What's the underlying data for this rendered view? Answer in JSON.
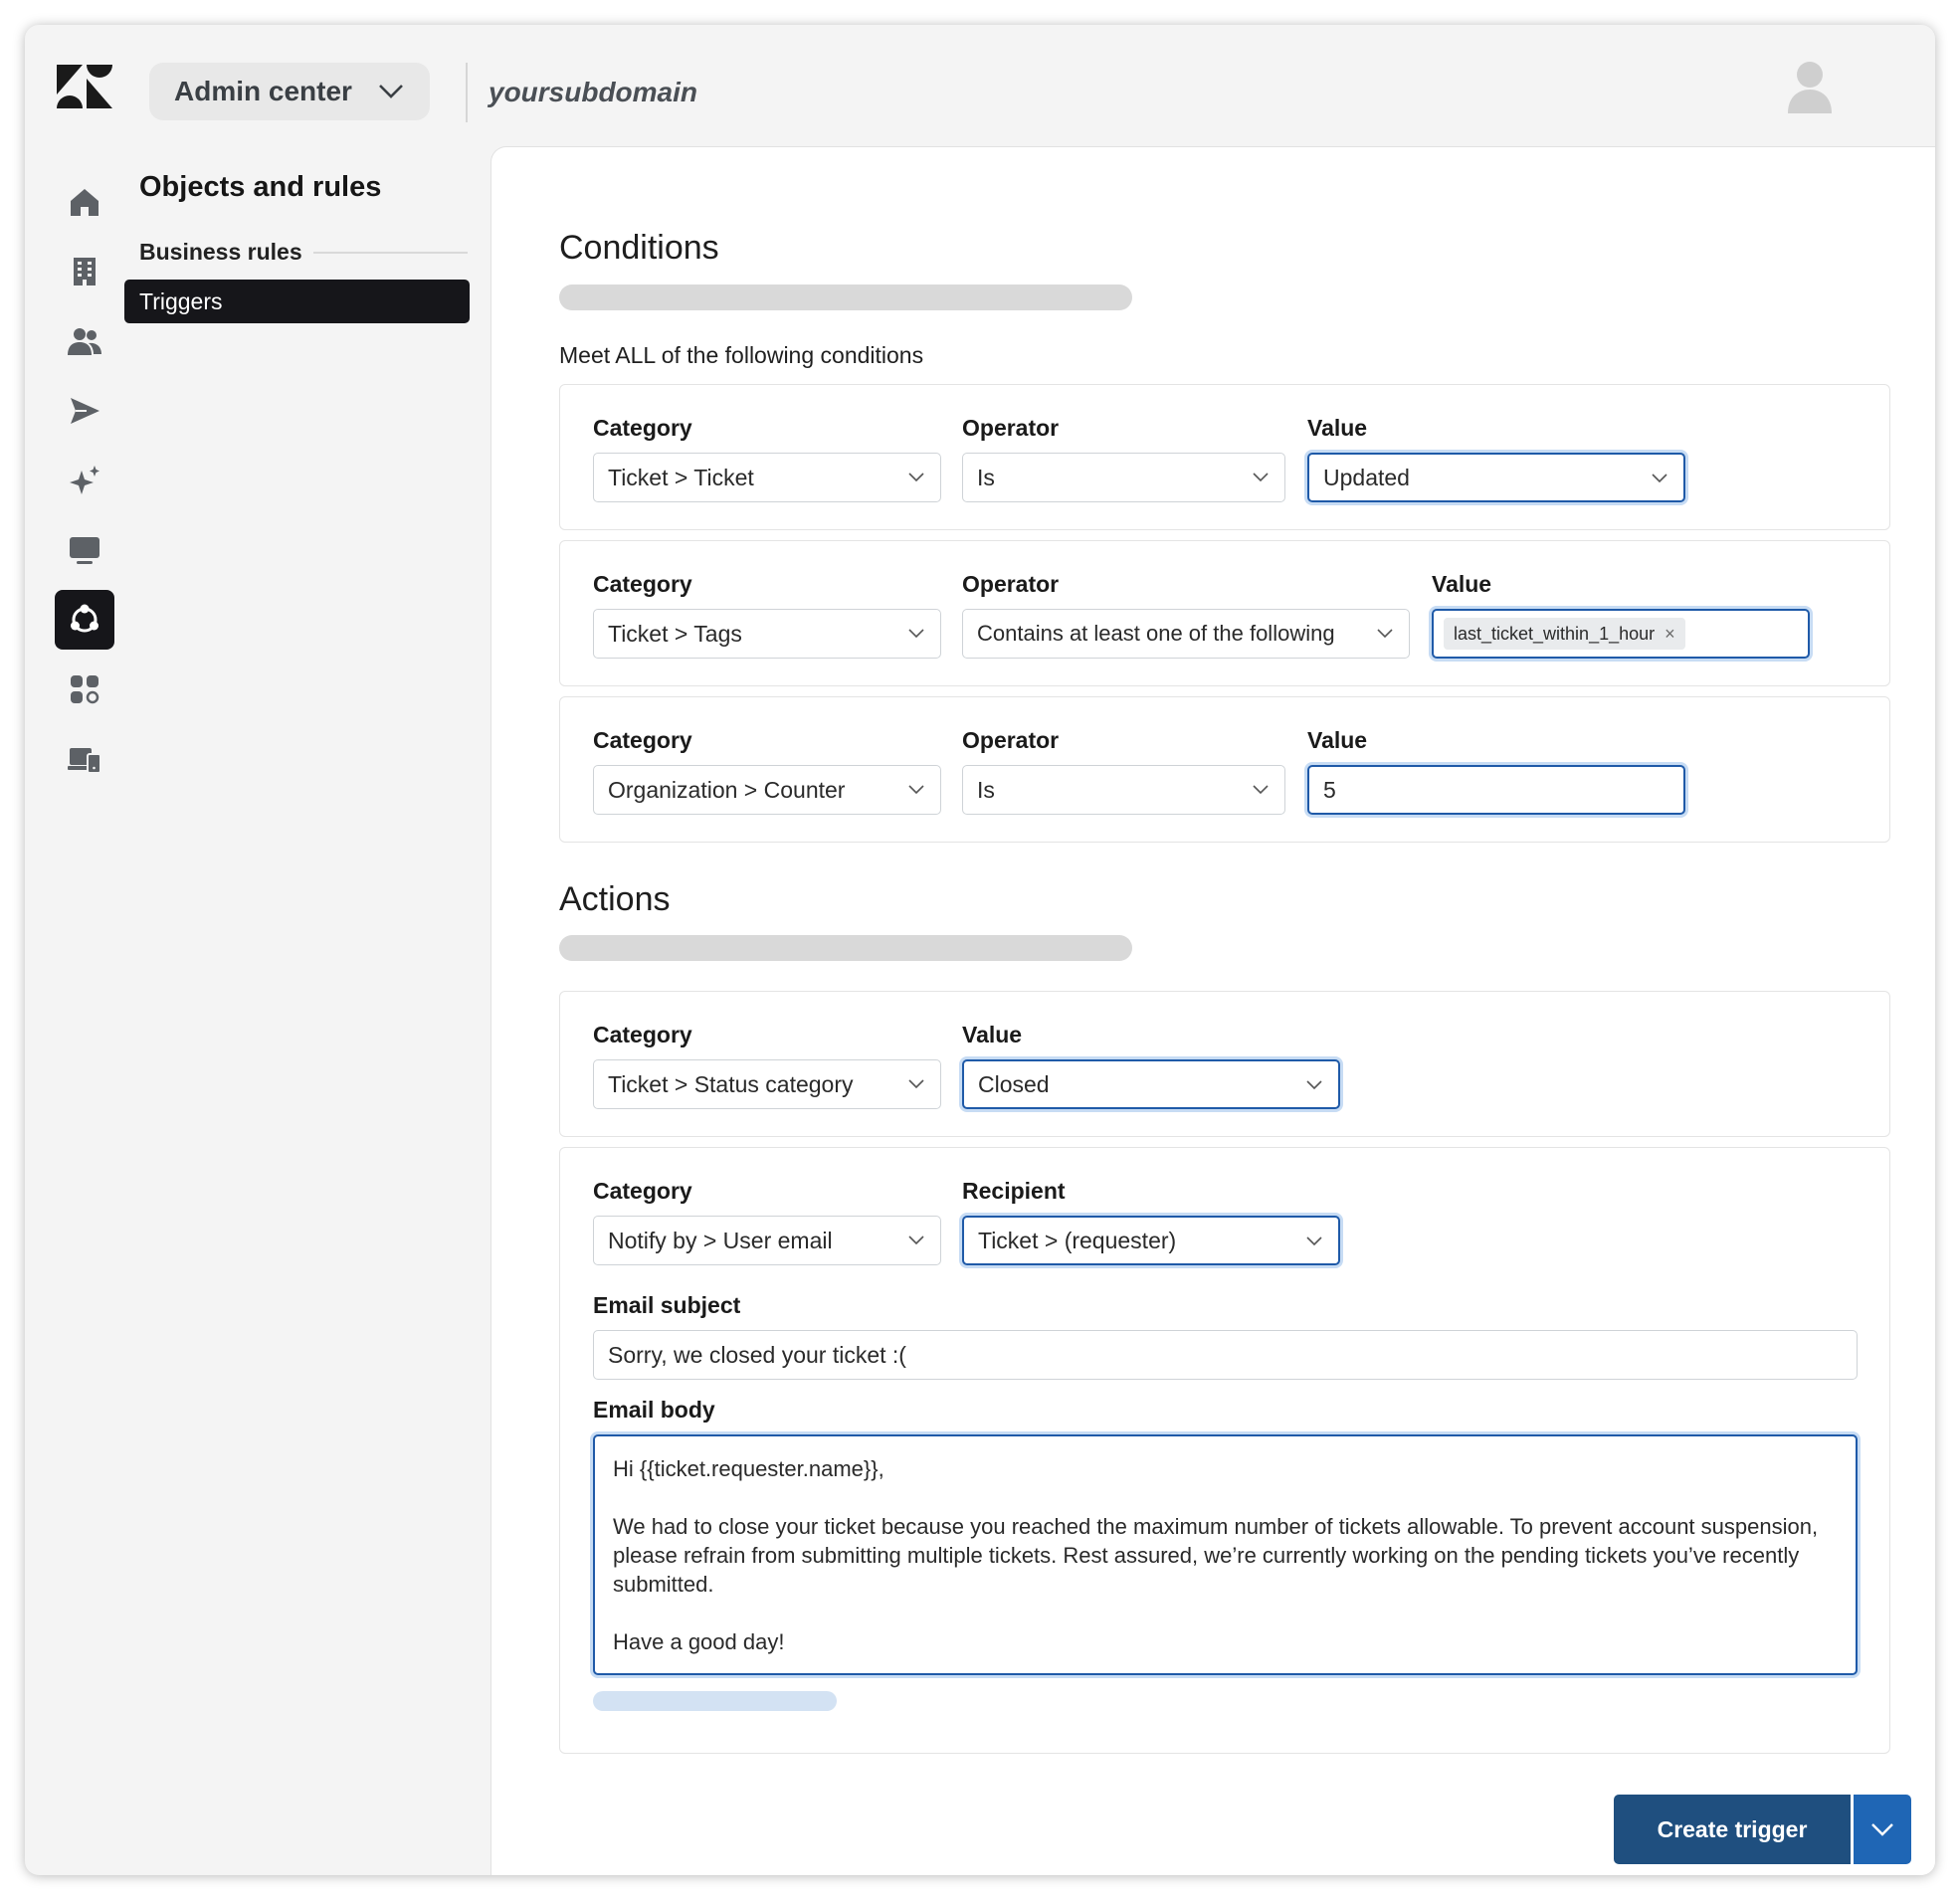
{
  "header": {
    "product_switcher": "Admin center",
    "subdomain": "yoursubdomain"
  },
  "rail": {
    "icons": [
      "home-icon",
      "building-icon",
      "people-icon",
      "send-icon",
      "sparkle-icon",
      "monitor-icon",
      "objects-rules-icon",
      "apps-icon",
      "devices-icon"
    ],
    "active": "objects-rules-icon"
  },
  "nav": {
    "title": "Objects and rules",
    "group": "Business rules",
    "active_item": "Triggers"
  },
  "conditions": {
    "title": "Conditions",
    "meet_label": "Meet ALL of the following conditions",
    "rows": [
      {
        "category_label": "Category",
        "category": "Ticket > Ticket",
        "operator_label": "Operator",
        "operator": "Is",
        "value_label": "Value",
        "value": "Updated"
      },
      {
        "category_label": "Category",
        "category": "Ticket > Tags",
        "operator_label": "Operator",
        "operator": "Contains at least one of the following",
        "value_label": "Value",
        "tag": "last_ticket_within_1_hour",
        "tag_remove": "×"
      },
      {
        "category_label": "Category",
        "category": "Organization > Counter",
        "operator_label": "Operator",
        "operator": "Is",
        "value_label": "Value",
        "value": "5"
      }
    ]
  },
  "actions": {
    "title": "Actions",
    "rows": [
      {
        "category_label": "Category",
        "category": "Ticket > Status category",
        "value_label": "Value",
        "value": "Closed"
      },
      {
        "category_label": "Category",
        "category": "Notify by > User email",
        "recipient_label": "Recipient",
        "recipient": "Ticket > (requester)",
        "subject_label": "Email subject",
        "subject": "Sorry, we closed your ticket :(",
        "body_label": "Email body",
        "body_lines": [
          "Hi {{ticket.requester.name}},",
          "We had to close your ticket because you reached the maximum number of tickets allowable. To prevent account suspension, please refrain from submitting multiple tickets. Rest assured, we’re currently working on the pending tickets you’ve recently submitted.",
          "Have a good day!"
        ]
      }
    ]
  },
  "footer": {
    "primary_button": "Create trigger"
  },
  "colors": {
    "primary": "#1f4f7f",
    "split": "#1f66b5",
    "focus": "#1f5aa8",
    "nav_active": "#16161a"
  }
}
